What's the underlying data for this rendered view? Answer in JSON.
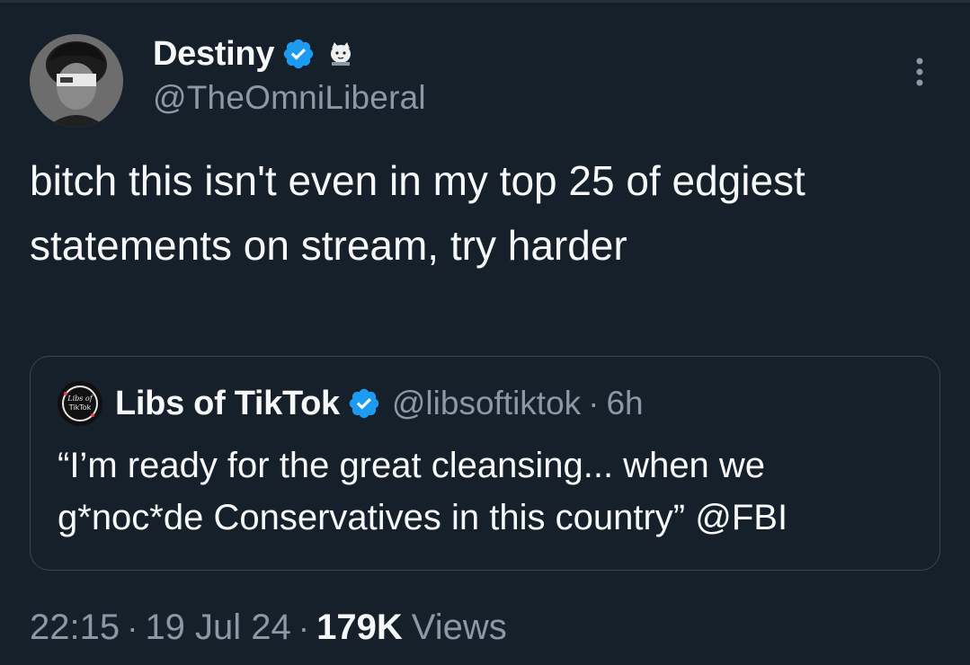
{
  "author": {
    "name": "Destiny",
    "handle": "@TheOmniLiberal"
  },
  "tweet": {
    "text": "bitch this isn't even in my top 25 of edgiest statements on stream, try harder"
  },
  "quoted_tweet": {
    "name": "Libs of TikTok",
    "handle": "@libsoftiktok",
    "separator": "·",
    "time": "6h",
    "text": "“I’m ready for the great cleansing... when we g*noc*de Conservatives in this country” @FBI",
    "avatar_text": "Libs of TikTok"
  },
  "meta": {
    "time": "22:15",
    "separator": "·",
    "date": "19 Jul 24",
    "views_count": "179K",
    "views_label": "Views"
  },
  "colors": {
    "background": "#15202b",
    "verified_blue": "#1d9bf0",
    "secondary_text": "#8b98a5",
    "border": "#38444d"
  },
  "icons": {
    "verified": "verified-badge-icon",
    "affiliate": "affiliate-badge-icon",
    "more": "more-options-icon"
  }
}
